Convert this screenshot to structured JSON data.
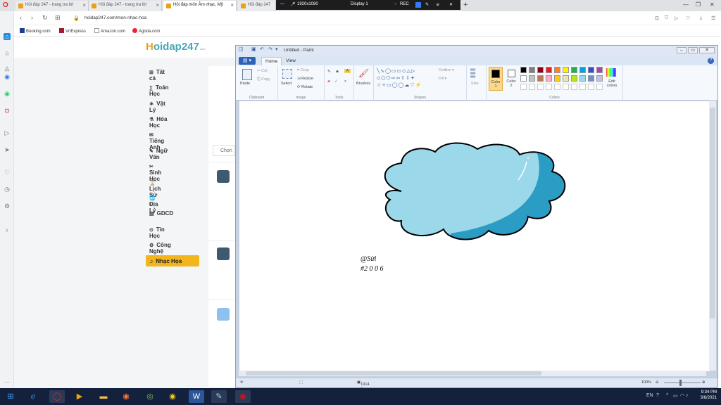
{
  "browser": {
    "tabs": [
      {
        "label": "Hỏi đáp 247 - trang tra lời"
      },
      {
        "label": "Hỏi đáp 247 - trang tra lời"
      },
      {
        "label": "Hỏi đáp môn Âm nhạc, Mỹ"
      },
      {
        "label": "Hỏi đáp 247"
      }
    ],
    "recorder": {
      "resolution": "1920x1080",
      "display": "Display 1",
      "rec": "REC"
    },
    "url": "hoidap247.com/mon-nhac-hoa",
    "bookmarks": [
      "Booking.com",
      "VnExpress",
      "Amazon.com",
      "Agoda.com"
    ]
  },
  "site": {
    "logo_h": "H",
    "logo_rest": "oidap247",
    "logo_sub": ".com",
    "subjects": [
      {
        "icon": "⊞",
        "label": "Tất cả"
      },
      {
        "icon": "∑",
        "label": "Toán Học"
      },
      {
        "icon": "⚛",
        "label": "Vật Lý"
      },
      {
        "icon": "⚗",
        "label": "Hóa Học"
      },
      {
        "icon": "✉",
        "label": "Tiếng Anh"
      },
      {
        "icon": "✎",
        "label": "Ngữ Văn"
      },
      {
        "icon": "✂",
        "label": "Sinh Học"
      },
      {
        "icon": "⌛",
        "label": "Lịch Sử"
      },
      {
        "icon": "🌐",
        "label": "Địa Lý"
      },
      {
        "icon": "▤",
        "label": "GDCD"
      },
      {
        "icon": "⊙",
        "label": "Tin Học"
      },
      {
        "icon": "⚙",
        "label": "Công Nghệ"
      },
      {
        "icon": "♫",
        "label": "Nhạc Họa"
      }
    ],
    "filter_label": "Chọn"
  },
  "paint": {
    "title": "Untitled - Paint",
    "tabs": {
      "file": "▤ ▾",
      "home": "Home",
      "view": "View"
    },
    "ribbon": {
      "paste": "Paste",
      "cut": "Cut",
      "copy": "Copy",
      "clipboard": "Clipboard",
      "select": "Select",
      "crop": "Crop",
      "resize": "Resize",
      "rotate": "Rotate",
      "image": "Image",
      "tools": "Tools",
      "brushes": "Brushes",
      "outline": "Outline",
      "fill": "Fill",
      "shapes": "Shapes",
      "size": "Size",
      "color1": "Color 1",
      "color2": "Color 2",
      "edit_colors": "Edit colors",
      "colors": "Colors"
    },
    "palette": [
      "#000000",
      "#7f7f7f",
      "#880015",
      "#ed1c24",
      "#ff7f27",
      "#fff200",
      "#22b14c",
      "#00a2e8",
      "#3f48cc",
      "#a349a4",
      "#ffffff",
      "#c3c3c3",
      "#b97a57",
      "#ffaec9",
      "#ffc90e",
      "#efe4b0",
      "#b5e61d",
      "#99d9ea",
      "#7092be",
      "#c8bfe7"
    ],
    "canvas_text": {
      "line1": "@Sửi",
      "line2": "#2 0 0 6"
    },
    "colors": {
      "cloud_light": "#9ad8ea",
      "cloud_dark": "#2b9cc3",
      "outline": "#000000"
    },
    "status": {
      "size": "1914 × 848px",
      "zoom": "100%"
    }
  },
  "taskbar": {
    "lang": "EN",
    "time": "9:34 PM",
    "date": "3/6/2021"
  }
}
